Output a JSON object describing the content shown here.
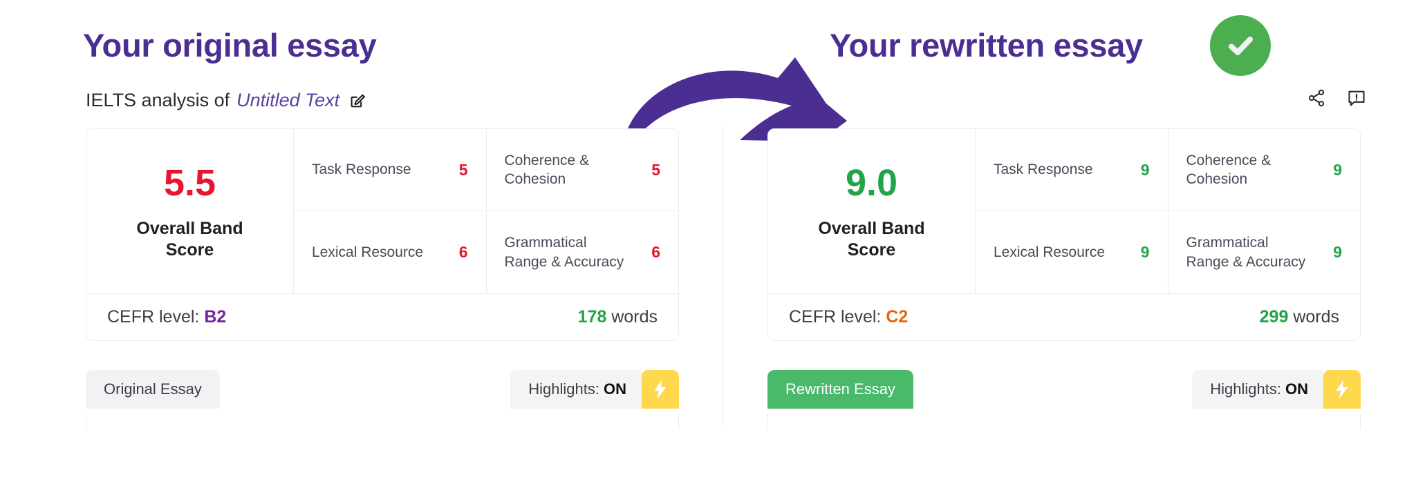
{
  "left_section": {
    "heading": "Your original essay",
    "subtitle_prefix": "IELTS analysis of",
    "document_name": "Untitled Text",
    "edit_icon": "edit-square-icon",
    "score": {
      "band_value": "5.5",
      "band_label": "Overall Band\nScore",
      "band_label_line1": "Overall Band",
      "band_label_line2": "Score",
      "band_color": "#e8152f",
      "criteria": [
        {
          "name": "Task Response",
          "score": "5"
        },
        {
          "name": "Coherence & Cohesion",
          "score": "5"
        },
        {
          "name": "Lexical Resource",
          "score": "6"
        },
        {
          "name": "Grammatical Range & Accuracy",
          "score": "6"
        }
      ],
      "criteria_color": "#e8152f",
      "cefr_label": "CEFR level:",
      "cefr_value": "B2",
      "cefr_color": "#7b1fa2",
      "words_count": "178",
      "words_label": "words"
    },
    "tab_label": "Original Essay",
    "tab_active": false,
    "highlights_label": "Highlights:",
    "highlights_state": "ON",
    "bolt_icon": "lightning-bolt-icon"
  },
  "right_section": {
    "heading": "Your rewritten essay",
    "badge_icon": "green-check-circle-icon",
    "share_icon": "share-icon",
    "report_icon": "report-comment-icon",
    "score": {
      "band_value": "9.0",
      "band_label_line1": "Overall Band",
      "band_label_line2": "Score",
      "band_color": "#22a44b",
      "criteria": [
        {
          "name": "Task Response",
          "score": "9"
        },
        {
          "name": "Coherence & Cohesion",
          "score": "9"
        },
        {
          "name": "Lexical Resource",
          "score": "9"
        },
        {
          "name": "Grammatical Range & Accuracy",
          "score": "9"
        }
      ],
      "criteria_color": "#22a44b",
      "cefr_label": "CEFR level:",
      "cefr_value": "C2",
      "cefr_color": "#e8640f",
      "words_count": "299",
      "words_label": "words"
    },
    "tab_label": "Rewritten Essay",
    "tab_active": true,
    "highlights_label": "Highlights:",
    "highlights_state": "ON",
    "bolt_icon": "lightning-bolt-icon"
  },
  "decoration": {
    "arrow_icon": "curved-right-arrow",
    "arrow_color": "#4b2e91"
  },
  "theme": {
    "heading_purple": "#4b2e91",
    "success_green": "#22a44b",
    "danger_red": "#e8152f",
    "accent_yellow": "#ffd84d",
    "tab_green": "#49b96a",
    "border": "#eceaf8"
  }
}
